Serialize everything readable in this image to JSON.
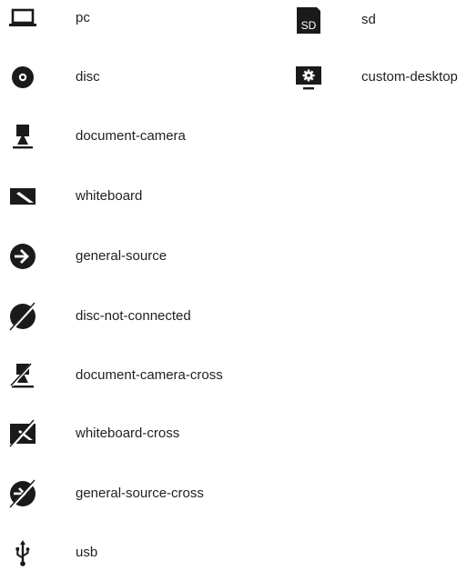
{
  "left_column": [
    {
      "label": "pc",
      "icon": "pc-icon"
    },
    {
      "label": "disc",
      "icon": "disc-icon"
    },
    {
      "label": "document-camera",
      "icon": "document-camera-icon"
    },
    {
      "label": "whiteboard",
      "icon": "whiteboard-icon"
    },
    {
      "label": "general-source",
      "icon": "general-source-icon"
    },
    {
      "label": "disc-not-connected",
      "icon": "disc-not-connected-icon"
    },
    {
      "label": "document-camera-cross",
      "icon": "document-camera-cross-icon"
    },
    {
      "label": "whiteboard-cross",
      "icon": "whiteboard-cross-icon"
    },
    {
      "label": "general-source-cross",
      "icon": "general-source-cross-icon"
    },
    {
      "label": "usb",
      "icon": "usb-icon"
    }
  ],
  "right_column": [
    {
      "label": "sd",
      "icon": "sd-icon",
      "icon_text": "SD"
    },
    {
      "label": "custom-desktop",
      "icon": "custom-desktop-icon"
    }
  ],
  "colors": {
    "icon": "#1a1a1a",
    "text": "#1f1f1f",
    "background": "#ffffff"
  }
}
